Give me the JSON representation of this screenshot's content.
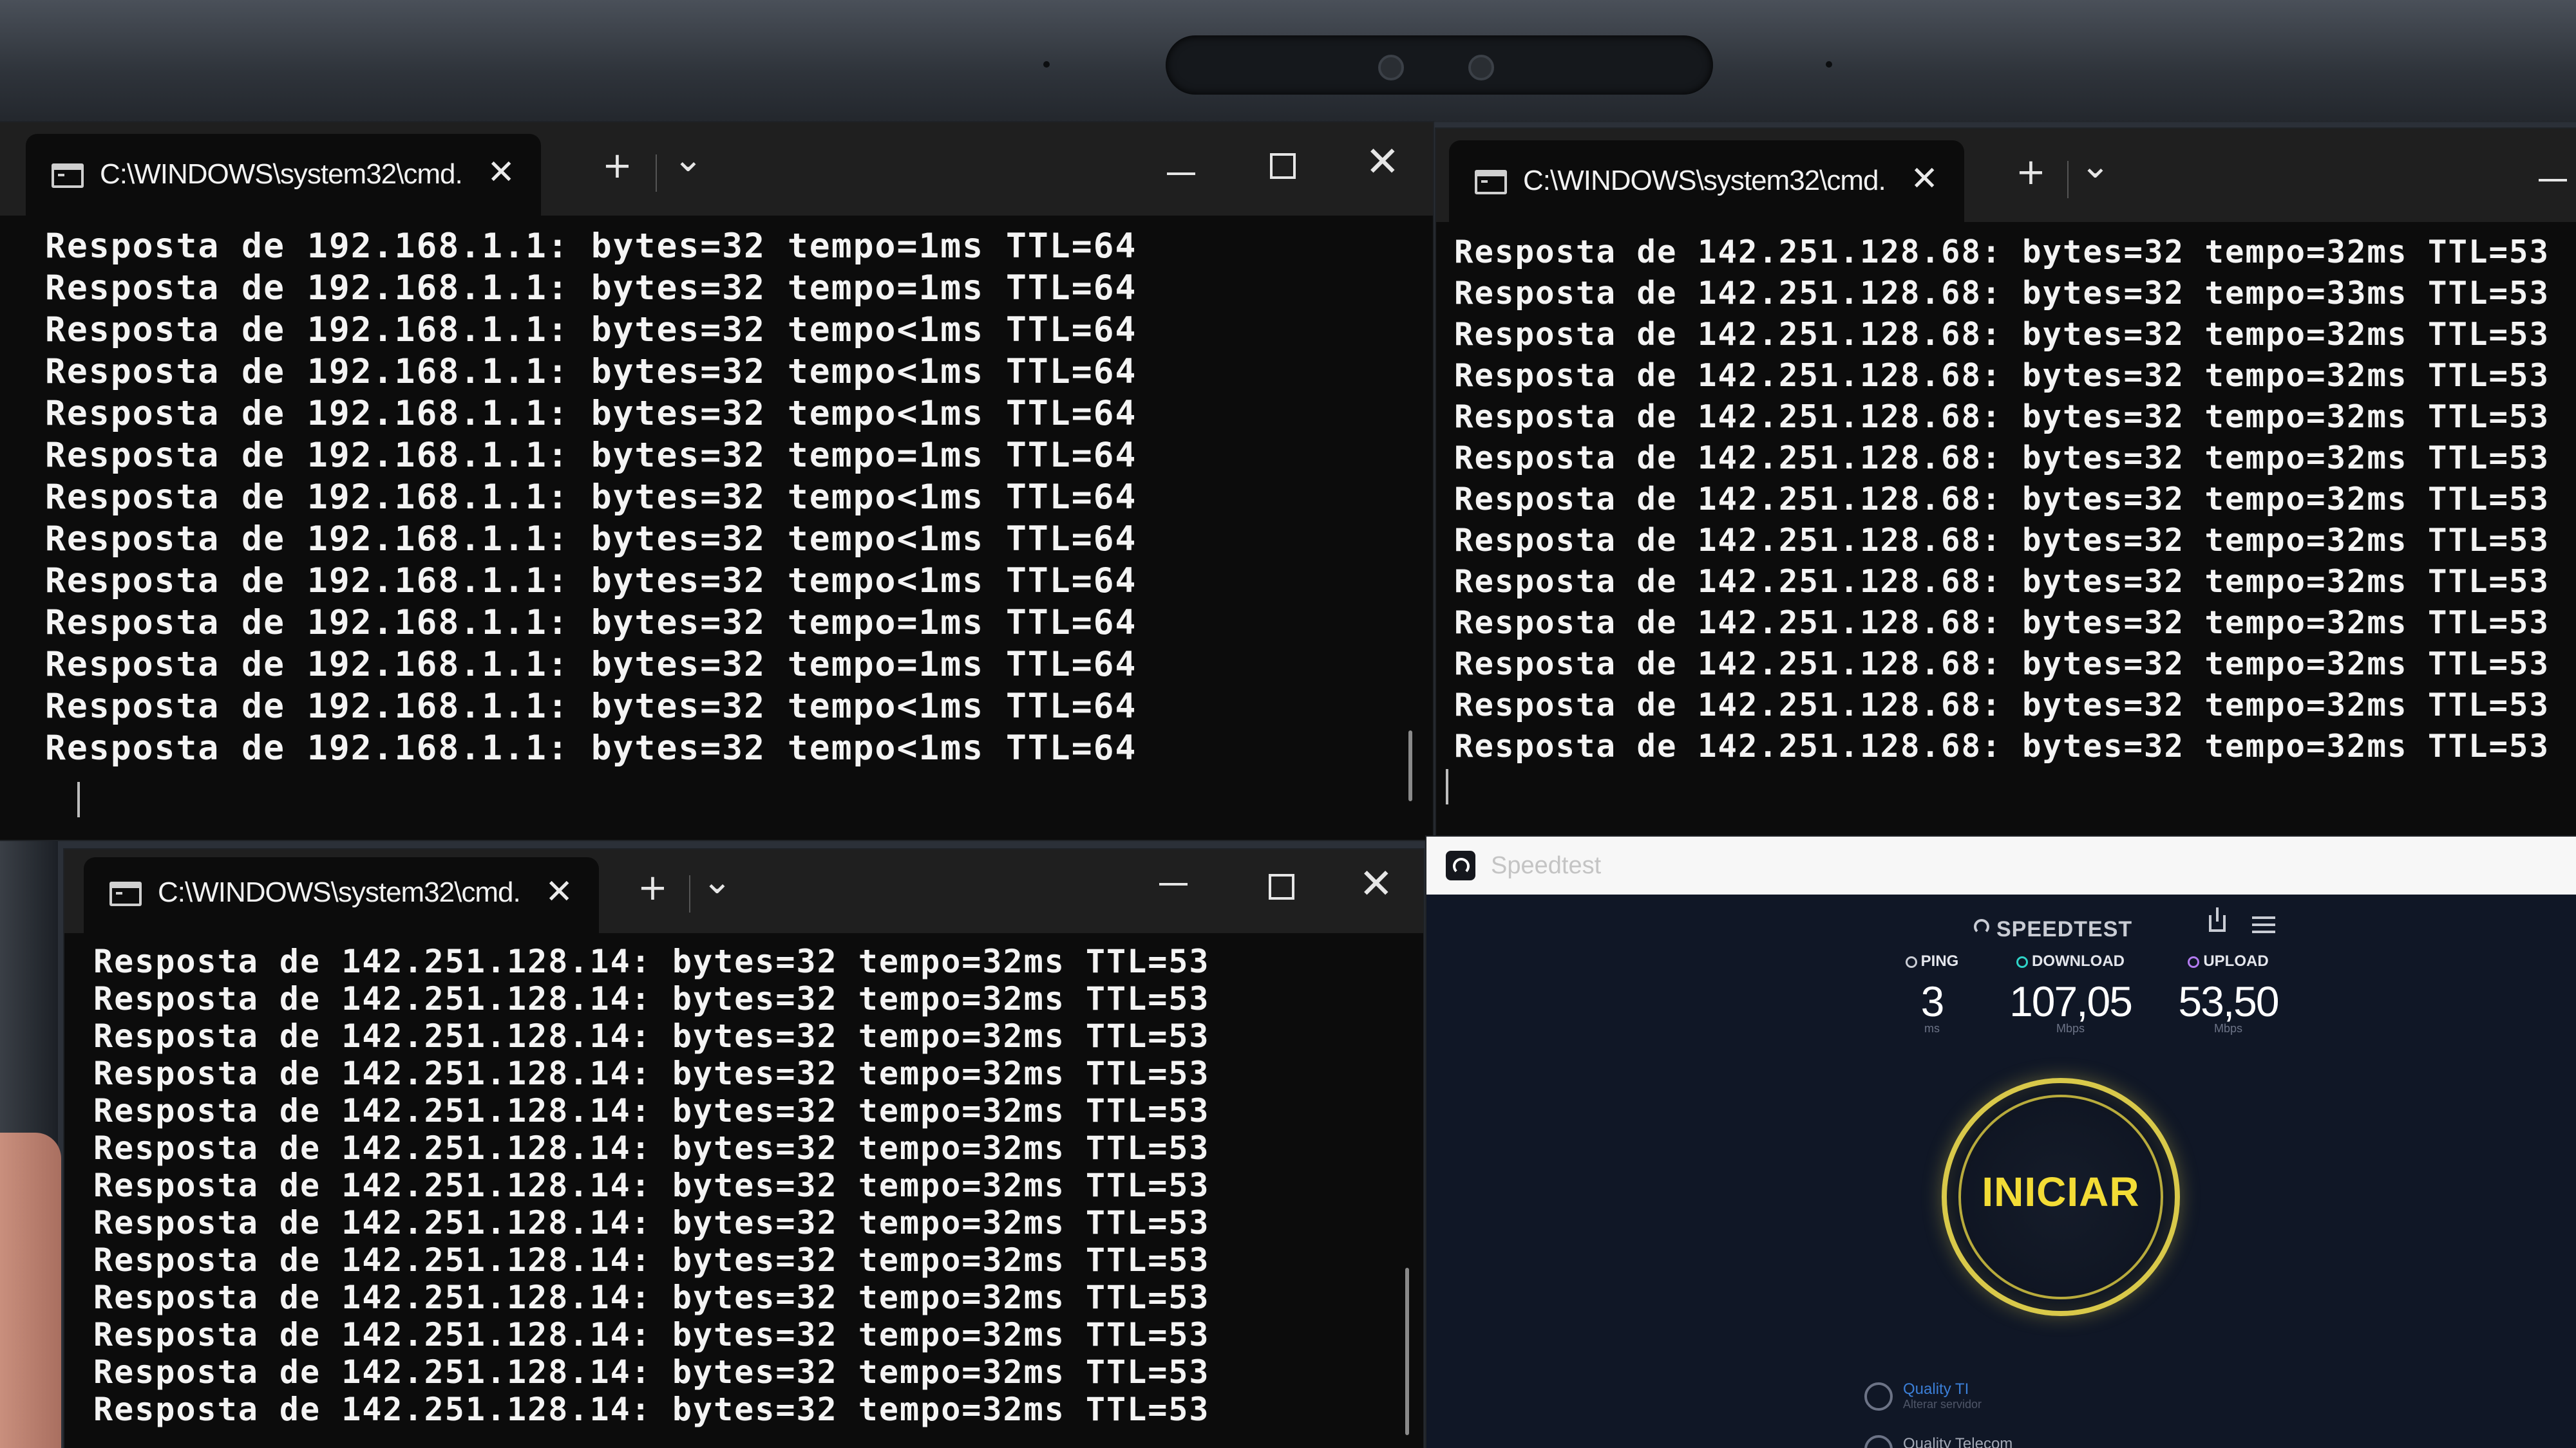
{
  "windows": {
    "top_left": {
      "tab_title": "C:\\WINDOWS\\system32\\cmd.",
      "lines": [
        "Resposta de 192.168.1.1: bytes=32 tempo=1ms TTL=64",
        "Resposta de 192.168.1.1: bytes=32 tempo=1ms TTL=64",
        "Resposta de 192.168.1.1: bytes=32 tempo<1ms TTL=64",
        "Resposta de 192.168.1.1: bytes=32 tempo<1ms TTL=64",
        "Resposta de 192.168.1.1: bytes=32 tempo<1ms TTL=64",
        "Resposta de 192.168.1.1: bytes=32 tempo=1ms TTL=64",
        "Resposta de 192.168.1.1: bytes=32 tempo<1ms TTL=64",
        "Resposta de 192.168.1.1: bytes=32 tempo<1ms TTL=64",
        "Resposta de 192.168.1.1: bytes=32 tempo<1ms TTL=64",
        "Resposta de 192.168.1.1: bytes=32 tempo=1ms TTL=64",
        "Resposta de 192.168.1.1: bytes=32 tempo=1ms TTL=64",
        "Resposta de 192.168.1.1: bytes=32 tempo<1ms TTL=64",
        "Resposta de 192.168.1.1: bytes=32 tempo<1ms TTL=64"
      ]
    },
    "top_right": {
      "tab_title": "C:\\WINDOWS\\system32\\cmd.",
      "lines": [
        "Resposta de 142.251.128.68: bytes=32 tempo=32ms TTL=53",
        "Resposta de 142.251.128.68: bytes=32 tempo=33ms TTL=53",
        "Resposta de 142.251.128.68: bytes=32 tempo=32ms TTL=53",
        "Resposta de 142.251.128.68: bytes=32 tempo=32ms TTL=53",
        "Resposta de 142.251.128.68: bytes=32 tempo=32ms TTL=53",
        "Resposta de 142.251.128.68: bytes=32 tempo=32ms TTL=53",
        "Resposta de 142.251.128.68: bytes=32 tempo=32ms TTL=53",
        "Resposta de 142.251.128.68: bytes=32 tempo=32ms TTL=53",
        "Resposta de 142.251.128.68: bytes=32 tempo=32ms TTL=53",
        "Resposta de 142.251.128.68: bytes=32 tempo=32ms TTL=53",
        "Resposta de 142.251.128.68: bytes=32 tempo=32ms TTL=53",
        "Resposta de 142.251.128.68: bytes=32 tempo=32ms TTL=53",
        "Resposta de 142.251.128.68: bytes=32 tempo=32ms TTL=53"
      ]
    },
    "bottom_left": {
      "tab_title": "C:\\WINDOWS\\system32\\cmd.",
      "lines": [
        "Resposta de 142.251.128.14: bytes=32 tempo=32ms TTL=53",
        "Resposta de 142.251.128.14: bytes=32 tempo=32ms TTL=53",
        "Resposta de 142.251.128.14: bytes=32 tempo=32ms TTL=53",
        "Resposta de 142.251.128.14: bytes=32 tempo=32ms TTL=53",
        "Resposta de 142.251.128.14: bytes=32 tempo=32ms TTL=53",
        "Resposta de 142.251.128.14: bytes=32 tempo=32ms TTL=53",
        "Resposta de 142.251.128.14: bytes=32 tempo=32ms TTL=53",
        "Resposta de 142.251.128.14: bytes=32 tempo=32ms TTL=53",
        "Resposta de 142.251.128.14: bytes=32 tempo=32ms TTL=53",
        "Resposta de 142.251.128.14: bytes=32 tempo=32ms TTL=53",
        "Resposta de 142.251.128.14: bytes=32 tempo=32ms TTL=53",
        "Resposta de 142.251.128.14: bytes=32 tempo=32ms TTL=53",
        "Resposta de 142.251.128.14: bytes=32 tempo=32ms TTL=53"
      ]
    }
  },
  "tab_controls": {
    "close": "✕",
    "new_tab": "+",
    "dropdown": "⌄"
  },
  "window_controls": {
    "close": "✕"
  },
  "speedtest": {
    "app_title": "Speedtest",
    "brand": "SPEEDTEST",
    "ping": {
      "label": "PING",
      "value": "3",
      "unit": "ms",
      "color": "#c9ccd4"
    },
    "download": {
      "label": "DOWNLOAD",
      "value": "107,05",
      "unit": "Mbps",
      "color": "#2fd3c7"
    },
    "upload": {
      "label": "UPLOAD",
      "value": "53,50",
      "unit": "Mbps",
      "color": "#b37bf0"
    },
    "go_button": "INICIAR",
    "isp_link": "Quality TI",
    "isp_sub": "Alterar servidor",
    "isp_name": "Quality Telecom"
  },
  "colors": {
    "terminal_bg": "#0c0c0c",
    "terminal_text": "#f4f4f4",
    "go_ring": "#d9c94a",
    "go_text": "#f3dc36"
  }
}
